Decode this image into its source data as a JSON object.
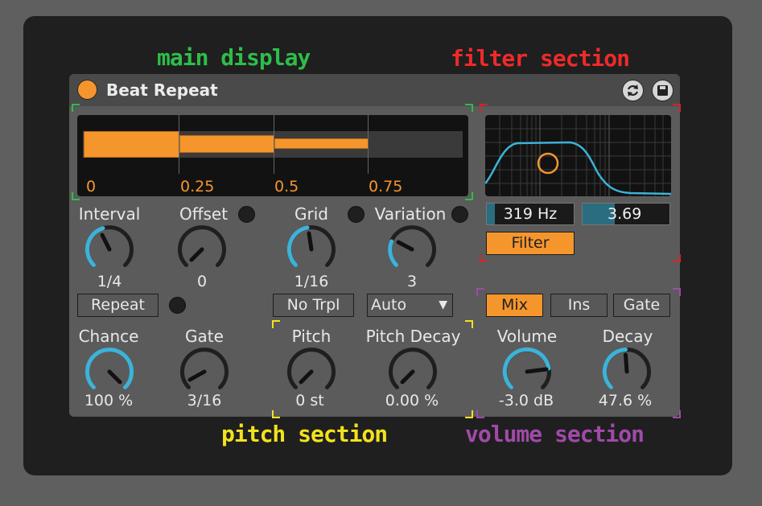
{
  "annotations": {
    "main_display": "main display",
    "filter_section": "filter section",
    "pitch_section": "pitch section",
    "volume_section": "volume section"
  },
  "device": {
    "title": "Beat Repeat",
    "power_on": true
  },
  "display": {
    "ticks": [
      "0",
      "0.25",
      "0.5",
      "0.75"
    ]
  },
  "filter": {
    "frequency": "319 Hz",
    "width": "3.69",
    "toggle_label": "Filter"
  },
  "controls": {
    "interval": {
      "label": "Interval",
      "value": "1/4"
    },
    "offset": {
      "label": "Offset",
      "value": "0"
    },
    "grid": {
      "label": "Grid",
      "value": "1/16"
    },
    "variation": {
      "label": "Variation",
      "value": "3"
    },
    "chance": {
      "label": "Chance",
      "value": "100 %"
    },
    "gate": {
      "label": "Gate",
      "value": "3/16"
    },
    "pitch": {
      "label": "Pitch",
      "value": "0 st"
    },
    "pitch_decay": {
      "label": "Pitch Decay",
      "value": "0.00 %"
    },
    "volume": {
      "label": "Volume",
      "value": "-3.0 dB"
    },
    "decay": {
      "label": "Decay",
      "value": "47.6 %"
    }
  },
  "buttons": {
    "repeat": "Repeat",
    "no_trpl": "No Trpl",
    "variation_mode": "Auto",
    "mix": "Mix",
    "ins": "Ins",
    "gate": "Gate"
  },
  "colors": {
    "accent": "#f5962d",
    "knob_arc": "#3cb3d8",
    "main_display_label": "#2fbd4a",
    "filter_section_label": "#ef2a2a",
    "pitch_section_label": "#f2e21c",
    "volume_section_label": "#a04aa8"
  }
}
